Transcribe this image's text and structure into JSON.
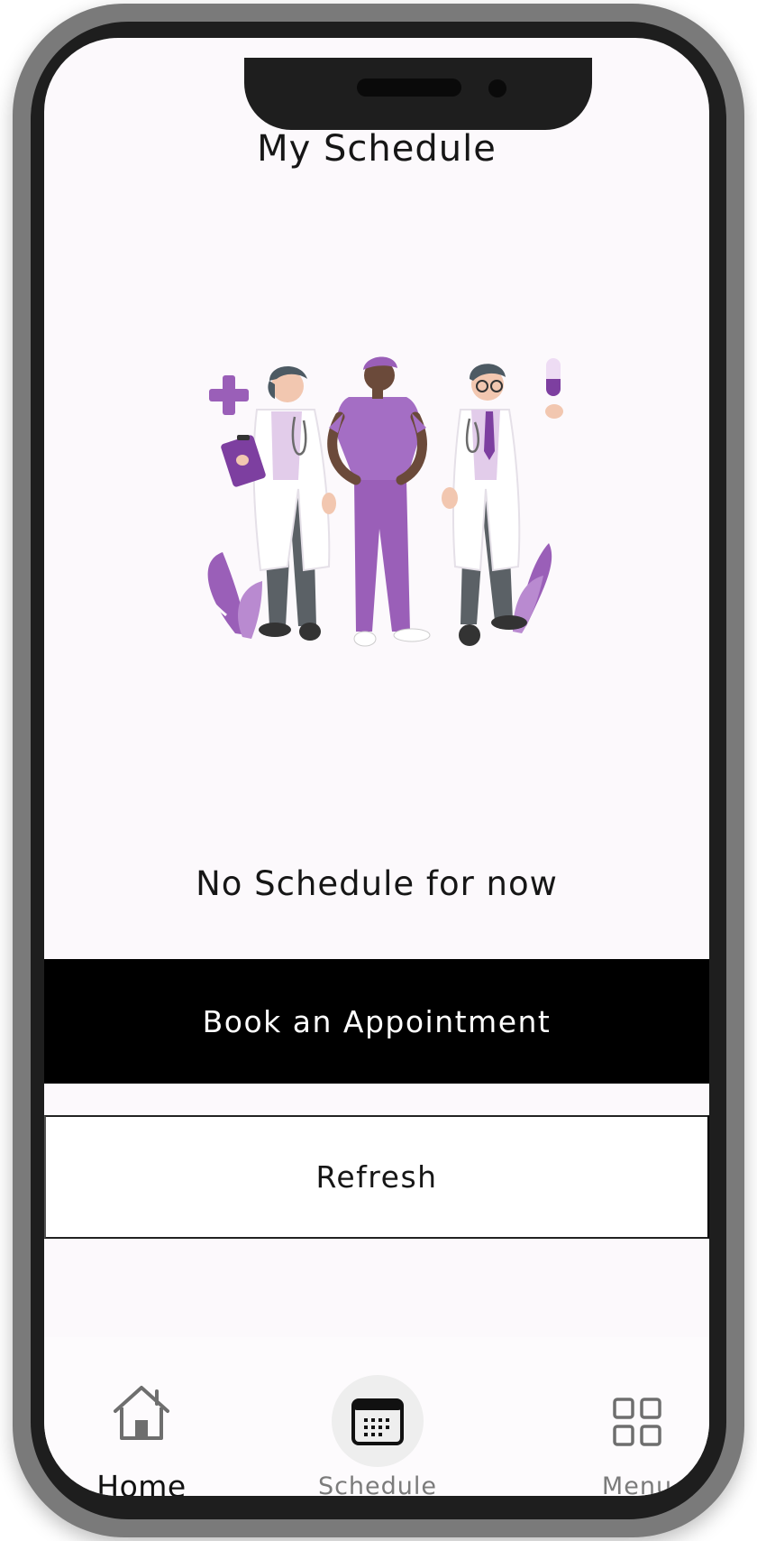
{
  "header": {
    "title": "My Schedule"
  },
  "illustration": {
    "icon": "medical-staff-illustration",
    "colors": {
      "accent": "#9a5fb8",
      "accent_dark": "#7d3fa0",
      "accent_light": "#e2ccea",
      "pants": "#5b6166",
      "skin": "#f2c7b0",
      "skin_dark": "#6b4a3a"
    }
  },
  "empty_state": {
    "message": "No Schedule for now"
  },
  "actions": {
    "book_label": "Book an Appointment",
    "refresh_label": "Refresh"
  },
  "tab_bar": {
    "tabs": [
      {
        "label": "Home",
        "icon": "home-icon",
        "active": false
      },
      {
        "label": "Schedule",
        "icon": "calendar-icon",
        "active": true
      },
      {
        "label": "Menu",
        "icon": "grid-icon",
        "active": false
      }
    ]
  },
  "theme": {
    "screen_bg": "#fcf9fc",
    "primary_button_bg": "#000000",
    "primary_button_text": "#ffffff",
    "inactive_tab_text": "#7b7b7b"
  }
}
